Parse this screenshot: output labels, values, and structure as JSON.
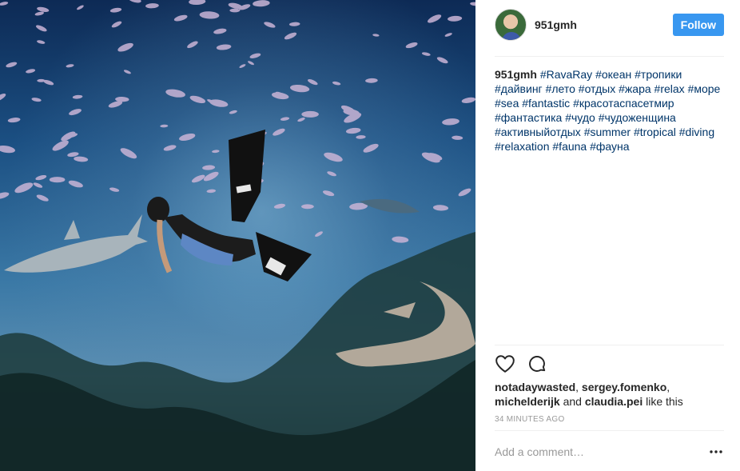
{
  "post": {
    "username": "951gmh",
    "follow_label": "Follow",
    "caption_username": "951gmh",
    "hashtags": [
      "#RavaRay",
      "#океан",
      "#тропики",
      "#дайвинг",
      "#лето",
      "#отдых",
      "#жара",
      "#relax",
      "#море",
      "#sea",
      "#fantastic",
      "#красотаспасетмир",
      "#фантастика",
      "#чудо",
      "#чудоженщина",
      "#активныйотдых",
      "#summer",
      "#tropical",
      "#diving",
      "#relaxation",
      "#fauna",
      "#фауна"
    ],
    "likes": {
      "users": [
        "notadaywasted",
        "sergey.fomenko",
        "michelderijk",
        "claudia.pei"
      ],
      "and_text": "and",
      "suffix": "like this"
    },
    "timestamp": "34 minutes ago",
    "comment_placeholder": "Add a comment…"
  },
  "icons": {
    "like": "heart-outline-icon",
    "comment": "speech-bubble-icon",
    "more": "ellipsis-icon"
  },
  "colors": {
    "follow_button": "#3897f0",
    "hashtag": "#003569",
    "muted": "#999999",
    "divider": "#efefef"
  }
}
